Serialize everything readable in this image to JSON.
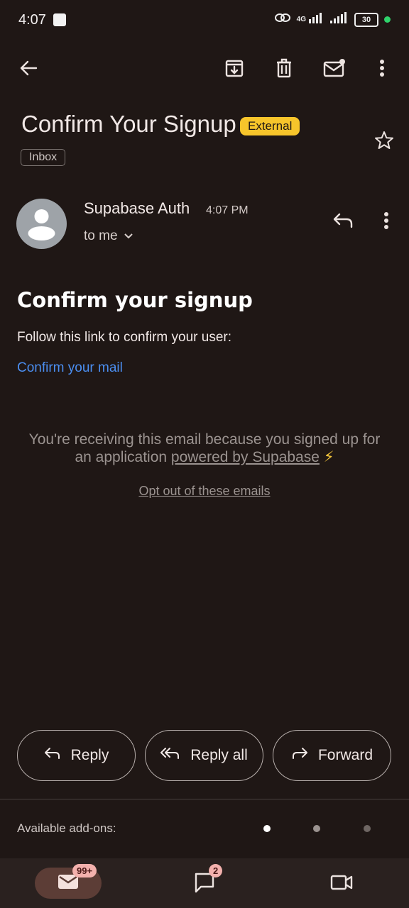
{
  "status_bar": {
    "time": "4:07",
    "network": "4G",
    "battery": "30"
  },
  "toolbar": {
    "icons": [
      "back-arrow-icon",
      "archive-icon",
      "delete-icon",
      "mark-unread-icon",
      "more-vertical-icon"
    ]
  },
  "email": {
    "subject": "Confirm Your Signup",
    "external_label": "External",
    "folder_label": "Inbox",
    "sender": "Supabase Auth",
    "time": "4:07 PM",
    "recipient": "to me",
    "body": {
      "heading": "Confirm your signup",
      "instruction": "Follow this link to confirm your user:",
      "link_text": "Confirm your mail",
      "footer_text_1": "You're receiving this email because you signed up for an application",
      "footer_link": "powered by Supabase",
      "footer_emoji": "⚡",
      "opt_out": "Opt out of these emails"
    }
  },
  "actions": {
    "reply": "Reply",
    "reply_all": "Reply all",
    "forward": "Forward"
  },
  "addons": {
    "label": "Available add-ons:"
  },
  "bottom_nav": {
    "mail_badge": "99+",
    "chat_badge": "2"
  },
  "colors": {
    "background": "#1f1715",
    "link": "#4b8ef0",
    "external_badge": "#f7c52b",
    "status_dot": "#2fd26b",
    "mail_pill": "#5c3d36"
  }
}
